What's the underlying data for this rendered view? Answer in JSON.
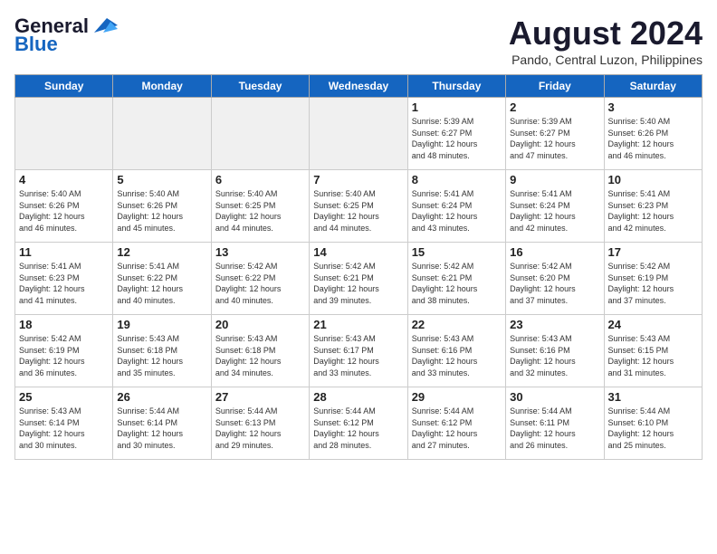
{
  "header": {
    "logo_general": "General",
    "logo_blue": "Blue",
    "month_title": "August 2024",
    "location": "Pando, Central Luzon, Philippines"
  },
  "days_of_week": [
    "Sunday",
    "Monday",
    "Tuesday",
    "Wednesday",
    "Thursday",
    "Friday",
    "Saturday"
  ],
  "weeks": [
    [
      {
        "day": "",
        "info": ""
      },
      {
        "day": "",
        "info": ""
      },
      {
        "day": "",
        "info": ""
      },
      {
        "day": "",
        "info": ""
      },
      {
        "day": "1",
        "info": "Sunrise: 5:39 AM\nSunset: 6:27 PM\nDaylight: 12 hours\nand 48 minutes."
      },
      {
        "day": "2",
        "info": "Sunrise: 5:39 AM\nSunset: 6:27 PM\nDaylight: 12 hours\nand 47 minutes."
      },
      {
        "day": "3",
        "info": "Sunrise: 5:40 AM\nSunset: 6:26 PM\nDaylight: 12 hours\nand 46 minutes."
      }
    ],
    [
      {
        "day": "4",
        "info": "Sunrise: 5:40 AM\nSunset: 6:26 PM\nDaylight: 12 hours\nand 46 minutes."
      },
      {
        "day": "5",
        "info": "Sunrise: 5:40 AM\nSunset: 6:26 PM\nDaylight: 12 hours\nand 45 minutes."
      },
      {
        "day": "6",
        "info": "Sunrise: 5:40 AM\nSunset: 6:25 PM\nDaylight: 12 hours\nand 44 minutes."
      },
      {
        "day": "7",
        "info": "Sunrise: 5:40 AM\nSunset: 6:25 PM\nDaylight: 12 hours\nand 44 minutes."
      },
      {
        "day": "8",
        "info": "Sunrise: 5:41 AM\nSunset: 6:24 PM\nDaylight: 12 hours\nand 43 minutes."
      },
      {
        "day": "9",
        "info": "Sunrise: 5:41 AM\nSunset: 6:24 PM\nDaylight: 12 hours\nand 42 minutes."
      },
      {
        "day": "10",
        "info": "Sunrise: 5:41 AM\nSunset: 6:23 PM\nDaylight: 12 hours\nand 42 minutes."
      }
    ],
    [
      {
        "day": "11",
        "info": "Sunrise: 5:41 AM\nSunset: 6:23 PM\nDaylight: 12 hours\nand 41 minutes."
      },
      {
        "day": "12",
        "info": "Sunrise: 5:41 AM\nSunset: 6:22 PM\nDaylight: 12 hours\nand 40 minutes."
      },
      {
        "day": "13",
        "info": "Sunrise: 5:42 AM\nSunset: 6:22 PM\nDaylight: 12 hours\nand 40 minutes."
      },
      {
        "day": "14",
        "info": "Sunrise: 5:42 AM\nSunset: 6:21 PM\nDaylight: 12 hours\nand 39 minutes."
      },
      {
        "day": "15",
        "info": "Sunrise: 5:42 AM\nSunset: 6:21 PM\nDaylight: 12 hours\nand 38 minutes."
      },
      {
        "day": "16",
        "info": "Sunrise: 5:42 AM\nSunset: 6:20 PM\nDaylight: 12 hours\nand 37 minutes."
      },
      {
        "day": "17",
        "info": "Sunrise: 5:42 AM\nSunset: 6:19 PM\nDaylight: 12 hours\nand 37 minutes."
      }
    ],
    [
      {
        "day": "18",
        "info": "Sunrise: 5:42 AM\nSunset: 6:19 PM\nDaylight: 12 hours\nand 36 minutes."
      },
      {
        "day": "19",
        "info": "Sunrise: 5:43 AM\nSunset: 6:18 PM\nDaylight: 12 hours\nand 35 minutes."
      },
      {
        "day": "20",
        "info": "Sunrise: 5:43 AM\nSunset: 6:18 PM\nDaylight: 12 hours\nand 34 minutes."
      },
      {
        "day": "21",
        "info": "Sunrise: 5:43 AM\nSunset: 6:17 PM\nDaylight: 12 hours\nand 33 minutes."
      },
      {
        "day": "22",
        "info": "Sunrise: 5:43 AM\nSunset: 6:16 PM\nDaylight: 12 hours\nand 33 minutes."
      },
      {
        "day": "23",
        "info": "Sunrise: 5:43 AM\nSunset: 6:16 PM\nDaylight: 12 hours\nand 32 minutes."
      },
      {
        "day": "24",
        "info": "Sunrise: 5:43 AM\nSunset: 6:15 PM\nDaylight: 12 hours\nand 31 minutes."
      }
    ],
    [
      {
        "day": "25",
        "info": "Sunrise: 5:43 AM\nSunset: 6:14 PM\nDaylight: 12 hours\nand 30 minutes."
      },
      {
        "day": "26",
        "info": "Sunrise: 5:44 AM\nSunset: 6:14 PM\nDaylight: 12 hours\nand 30 minutes."
      },
      {
        "day": "27",
        "info": "Sunrise: 5:44 AM\nSunset: 6:13 PM\nDaylight: 12 hours\nand 29 minutes."
      },
      {
        "day": "28",
        "info": "Sunrise: 5:44 AM\nSunset: 6:12 PM\nDaylight: 12 hours\nand 28 minutes."
      },
      {
        "day": "29",
        "info": "Sunrise: 5:44 AM\nSunset: 6:12 PM\nDaylight: 12 hours\nand 27 minutes."
      },
      {
        "day": "30",
        "info": "Sunrise: 5:44 AM\nSunset: 6:11 PM\nDaylight: 12 hours\nand 26 minutes."
      },
      {
        "day": "31",
        "info": "Sunrise: 5:44 AM\nSunset: 6:10 PM\nDaylight: 12 hours\nand 25 minutes."
      }
    ]
  ]
}
